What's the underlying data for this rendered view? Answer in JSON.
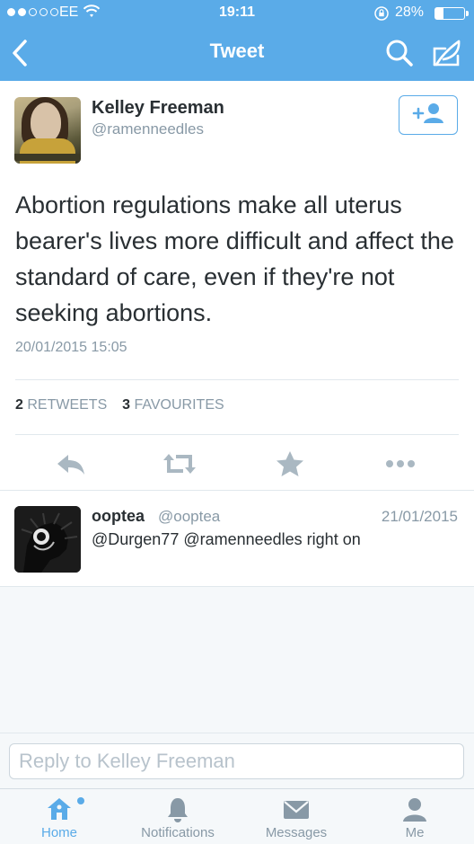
{
  "status_bar": {
    "carrier": "EE",
    "time": "19:11",
    "battery": "28%",
    "battery_level": 0.28
  },
  "nav": {
    "title": "Tweet",
    "back_icon": "chevron-left-icon",
    "search_icon": "search-icon",
    "compose_icon": "compose-icon"
  },
  "tweet": {
    "name": "Kelley Freeman",
    "handle": "@ramenneedles",
    "text": "Abortion regulations make all uterus bearer's lives more difficult and affect the standard of care, even if they're not seeking abortions.",
    "timestamp": "20/01/2015 15:05",
    "retweets_count": "2",
    "retweets_label": "RETWEETS",
    "favourites_count": "3",
    "favourites_label": "FAVOURITES",
    "follow_icon": "add-user-icon"
  },
  "actions": [
    "reply-icon",
    "retweet-icon",
    "favourite-star-icon",
    "more-icon"
  ],
  "reply": {
    "name": "ooptea",
    "handle": "@ooptea",
    "date": "21/01/2015",
    "text": "@Durgen77 @ramenneedles right on"
  },
  "reply_input": {
    "placeholder": "Reply to Kelley Freeman"
  },
  "tabs": [
    {
      "label": "Home",
      "icon": "home-icon",
      "active": true
    },
    {
      "label": "Notifications",
      "icon": "bell-icon",
      "active": false
    },
    {
      "label": "Messages",
      "icon": "envelope-icon",
      "active": false
    },
    {
      "label": "Me",
      "icon": "person-icon",
      "active": false
    }
  ],
  "colors": {
    "brand": "#5aabe8",
    "text": "#292f33",
    "muted": "#8899a6"
  }
}
